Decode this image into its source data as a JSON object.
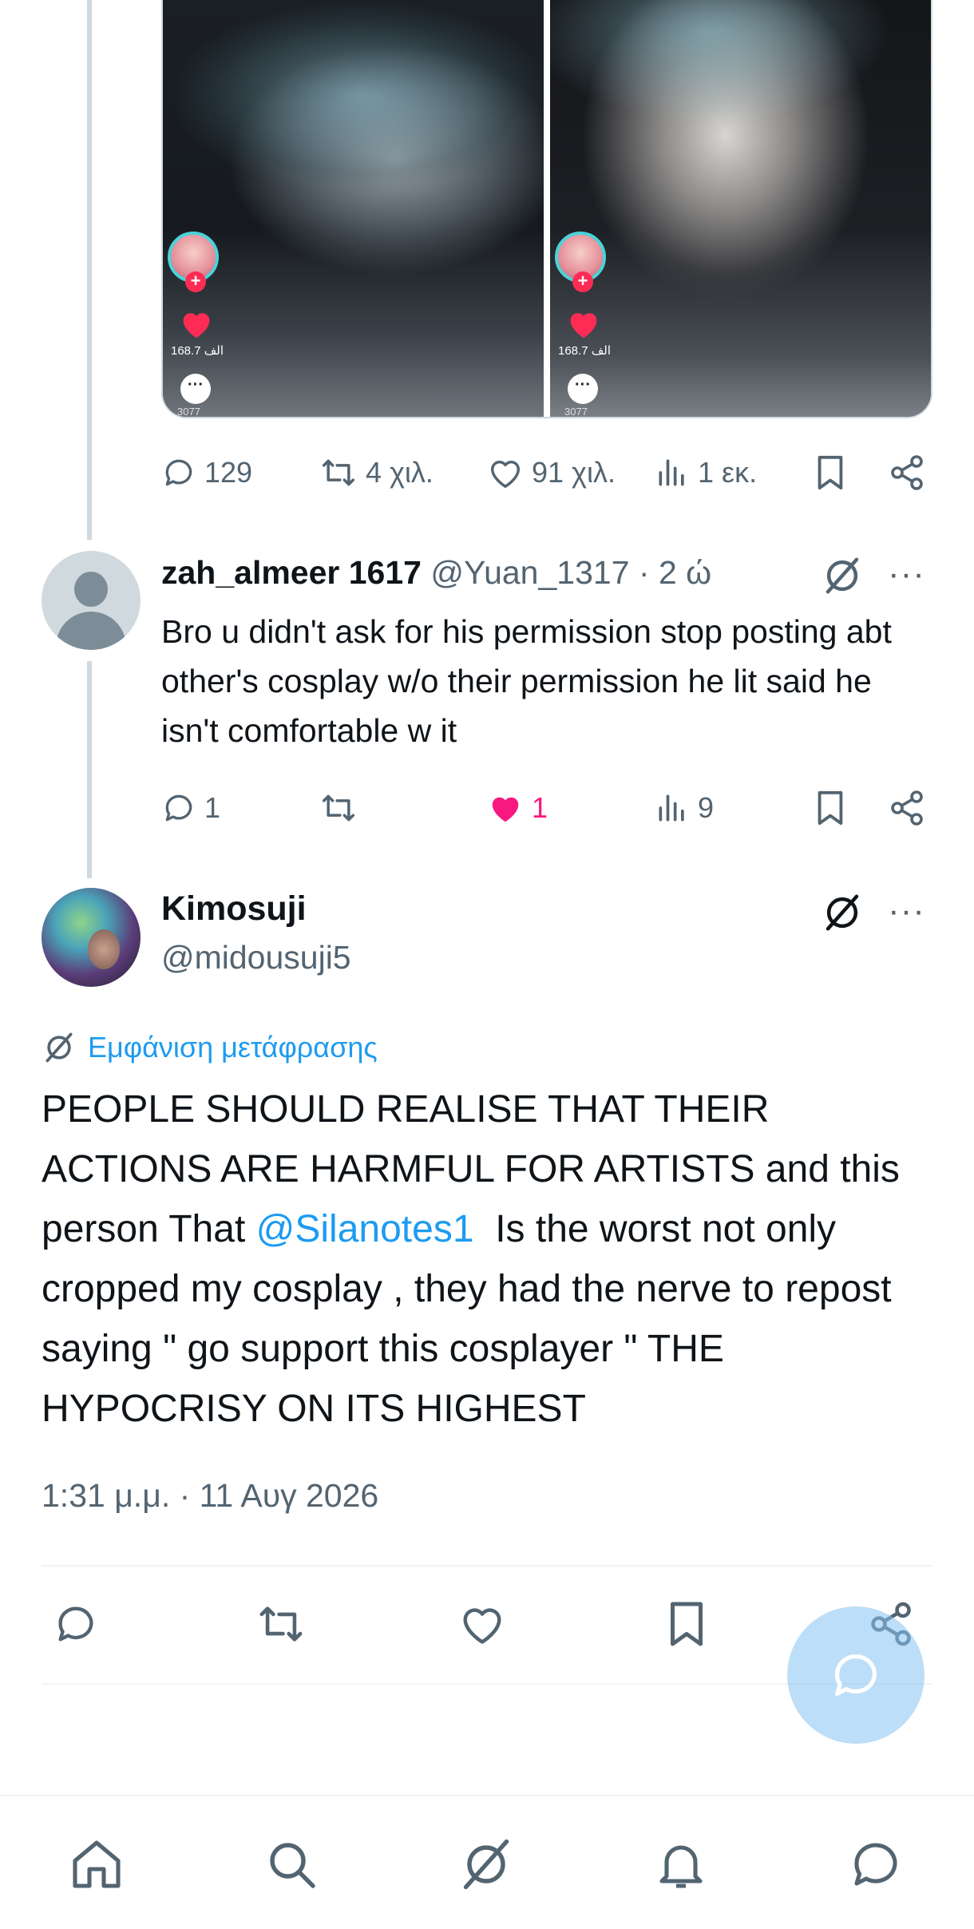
{
  "media": {
    "frames": [
      {
        "like_count": "168.7 الف",
        "comment_count": "3077"
      },
      {
        "like_count": "168.7 الف",
        "comment_count": "3077"
      }
    ]
  },
  "parent_actions": {
    "replies": "129",
    "reposts": "4 χιλ.",
    "likes": "91 χιλ.",
    "views": "1 εκ."
  },
  "reply": {
    "name": "zah_almeer 1617",
    "handle": "@Yuan_1317",
    "separator": "·",
    "time": "2 ώ",
    "text": "Bro u didn't ask for his permission stop posting abt other's cosplay w/o their permission he lit said he isn't comfortable w it",
    "replies": "1",
    "likes": "1",
    "views": "9"
  },
  "tweet": {
    "name": "Kimosuji",
    "handle": "@midousuji5",
    "translate_label": "Εμφάνιση μετάφρασης",
    "text_before": "PEOPLE SHOULD REALISE THAT THEIR ACTIONS ARE HARMFUL FOR ARTISTS and this person That ",
    "mention": "@Silanotes1",
    "text_after": "  Is the worst not only cropped my cosplay , they had the nerve to repost saying \" go support this cosplayer \" THE HYPOCRISY ON ITS HIGHEST",
    "timestamp": "1:31 μ.μ. · 11 Αυγ 2026"
  },
  "icons": {
    "reply": "reply-icon",
    "repost": "repost-icon",
    "like": "heart-icon",
    "views": "views-icon",
    "bookmark": "bookmark-icon",
    "share": "share-icon",
    "grok": "grok-icon",
    "more": "more-icon",
    "nav": [
      "home-icon",
      "search-icon",
      "grok-icon",
      "notifications-icon",
      "messages-icon"
    ]
  },
  "colors": {
    "accent": "#1d9bf0",
    "like_active": "#f91880",
    "secondary_text": "#536471",
    "fab": "#86c2f3"
  }
}
